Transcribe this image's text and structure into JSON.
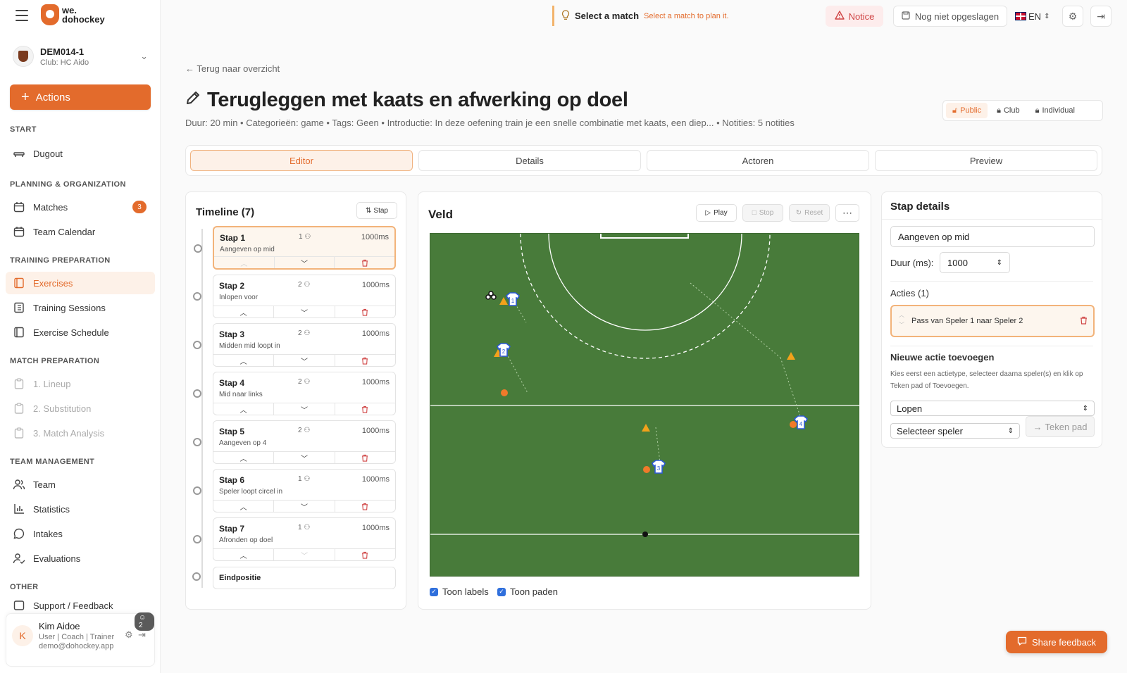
{
  "app": {
    "logo_line1": "we.",
    "logo_line2": "dohockey"
  },
  "team": {
    "name": "DEM014-1",
    "club": "Club: HC Aido"
  },
  "sidebar": {
    "actions_label": "Actions",
    "sections": {
      "start": "START",
      "planning": "PLANNING & ORGANIZATION",
      "training": "TRAINING PREPARATION",
      "match": "MATCH PREPARATION",
      "team": "TEAM MANAGEMENT",
      "other": "OTHER"
    },
    "items": {
      "dugout": "Dugout",
      "matches": "Matches",
      "matches_badge": "3",
      "calendar": "Team Calendar",
      "exercises": "Exercises",
      "sessions": "Training Sessions",
      "schedule": "Exercise Schedule",
      "lineup": "1. Lineup",
      "substitution": "2. Substitution",
      "analysis": "3. Match Analysis",
      "team": "Team",
      "statistics": "Statistics",
      "intakes": "Intakes",
      "evaluations": "Evaluations",
      "support": "Support / Feedback"
    }
  },
  "user": {
    "initial": "K",
    "name": "Kim Aidoe",
    "role": "User | Coach | Trainer",
    "email": "demo@dohockey.app",
    "count": "2"
  },
  "topbar": {
    "select_match_title": "Select a match",
    "select_match_sub": "Select a match to plan it.",
    "notice": "Notice",
    "not_saved": "Nog niet opgeslagen",
    "lang": "EN"
  },
  "page": {
    "back": "Terug naar overzicht",
    "title": "Terugleggen met kaats en afwerking op doel",
    "meta": "Duur: 20 min • Categorieën: game • Tags: Geen • Introductie: In deze oefening train je een snelle combinatie met kaats, een diep... • Notities: 5 notities",
    "visibility": [
      "Public",
      "Club",
      "Individual"
    ]
  },
  "tabs": [
    "Editor",
    "Details",
    "Actoren",
    "Preview"
  ],
  "timeline": {
    "title": "Timeline (7)",
    "add_label": "Stap",
    "steps": [
      {
        "name": "Stap 1",
        "players": "1",
        "dur": "1000ms",
        "desc": "Aangeven op mid"
      },
      {
        "name": "Stap 2",
        "players": "2",
        "dur": "1000ms",
        "desc": "Inlopen voor"
      },
      {
        "name": "Stap 3",
        "players": "2",
        "dur": "1000ms",
        "desc": "Midden mid loopt in"
      },
      {
        "name": "Stap 4",
        "players": "2",
        "dur": "1000ms",
        "desc": "Mid naar links"
      },
      {
        "name": "Stap 5",
        "players": "2",
        "dur": "1000ms",
        "desc": "Aangeven op 4"
      },
      {
        "name": "Stap 6",
        "players": "1",
        "dur": "1000ms",
        "desc": "Speler loopt circel in"
      },
      {
        "name": "Stap 7",
        "players": "1",
        "dur": "1000ms",
        "desc": "Afronden op doel"
      }
    ],
    "end_label": "Eindpositie"
  },
  "field": {
    "title": "Veld",
    "play": "Play",
    "stop": "Stop",
    "reset": "Reset",
    "show_labels": "Toon labels",
    "show_paths": "Toon paden",
    "players": [
      {
        "number": "1"
      },
      {
        "number": "2"
      },
      {
        "number": "3"
      },
      {
        "number": "4"
      }
    ]
  },
  "details": {
    "title": "Stap details",
    "name_value": "Aangeven op mid",
    "duration_label": "Duur (ms):",
    "duration_value": "1000",
    "actions_title": "Acties (1)",
    "action_text": "Pass van Speler 1 naar Speler 2",
    "new_action_title": "Nieuwe actie toevoegen",
    "help": "Kies eerst een actietype, selecteer daarna speler(s) en klik op Teken pad of Toevoegen.",
    "type_value": "Lopen",
    "player_placeholder": "Selecteer speler",
    "draw_path": "Teken pad"
  },
  "share_feedback": "Share feedback"
}
